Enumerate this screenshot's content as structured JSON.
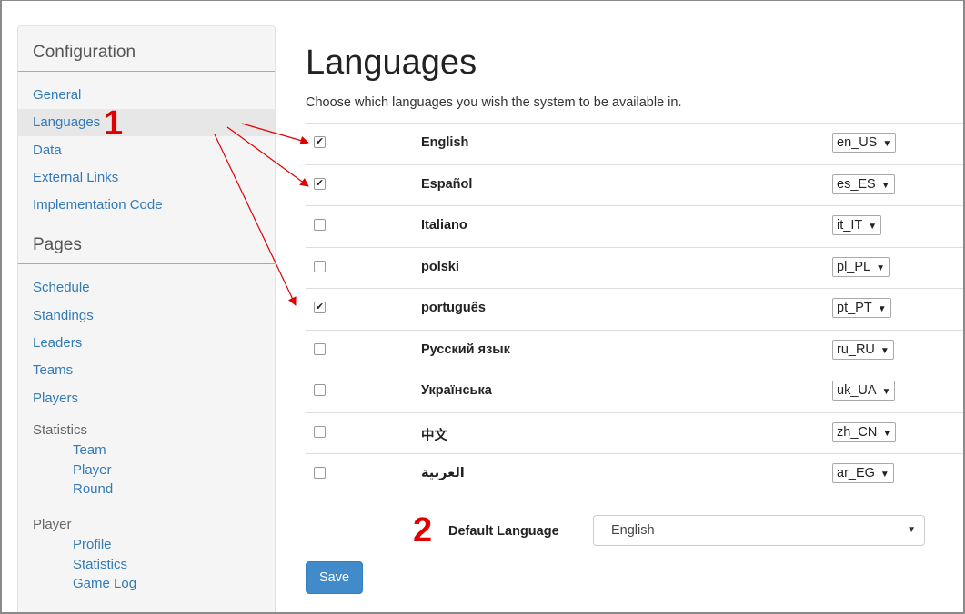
{
  "sidebar": {
    "config_heading": "Configuration",
    "config_links": [
      "General",
      "Languages",
      "Data",
      "External Links",
      "Implementation Code"
    ],
    "pages_heading": "Pages",
    "page_links": [
      "Schedule",
      "Standings",
      "Leaders",
      "Teams",
      "Players"
    ],
    "statistics_group": "Statistics",
    "statistics_links": [
      "Team",
      "Player",
      "Round"
    ],
    "player_group": "Player",
    "player_links": [
      "Profile",
      "Statistics",
      "Game Log"
    ]
  },
  "main": {
    "title": "Languages",
    "subtitle": "Choose which languages you wish the system to be available in.",
    "languages": [
      {
        "name": "English",
        "locale": "en_US",
        "checked": true
      },
      {
        "name": "Español",
        "locale": "es_ES",
        "checked": true
      },
      {
        "name": "Italiano",
        "locale": "it_IT",
        "checked": false
      },
      {
        "name": "polski",
        "locale": "pl_PL",
        "checked": false
      },
      {
        "name": "português",
        "locale": "pt_PT",
        "checked": true
      },
      {
        "name": "Русский язык",
        "locale": "ru_RU",
        "checked": false
      },
      {
        "name": "Українська",
        "locale": "uk_UA",
        "checked": false
      },
      {
        "name": "中文",
        "locale": "zh_CN",
        "checked": false
      },
      {
        "name": "العربية",
        "locale": "ar_EG",
        "checked": false
      }
    ],
    "default_language_label": "Default Language",
    "default_language_value": "English",
    "save_label": "Save"
  },
  "annotations": {
    "marker_1": "1",
    "marker_2": "2",
    "color": "#e00000"
  },
  "icons": {
    "checkmark": "✔",
    "dropdown_caret": "▼"
  }
}
